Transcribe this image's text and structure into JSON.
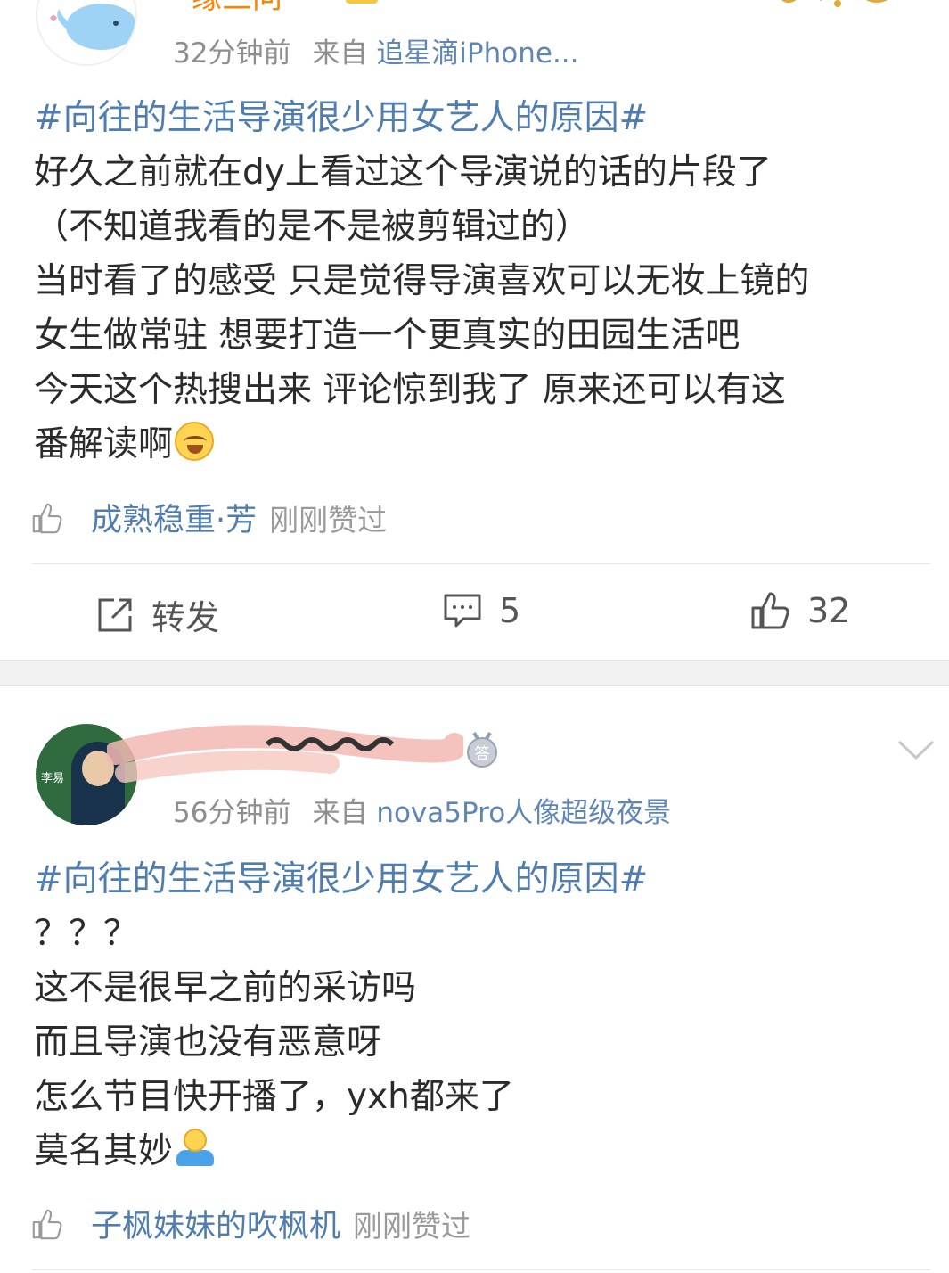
{
  "post1": {
    "username": "缘三问",
    "time": "32分钟前",
    "source_prefix": "来自",
    "source": "追星滴iPhone...",
    "hashtag": "#向往的生活导演很少用女艺人的原因#",
    "lines": [
      "好久之前就在dy上看过这个导演说的话的片段了",
      "（不知道我看的是不是被剪辑过的）",
      "当时看了的感受 只是觉得导演喜欢可以无妆上镜的",
      "女生做常驻 想要打造一个更真实的田园生活吧",
      "今天这个热搜出来 评论惊到我了 原来还可以有这"
    ],
    "last_line": "番解读啊",
    "emoji": "laugh-cry-emoji",
    "liker": "成熟稳重·芳",
    "liked_text": "刚刚赞过"
  },
  "actions": {
    "repost_label": "转发",
    "comment_count": "5",
    "like_count": "32"
  },
  "post2": {
    "username": "",
    "avatar_label": "李易",
    "time": "56分钟前",
    "source_prefix": "来自",
    "source": "nova5Pro人像超级夜景",
    "hashtag": "#向往的生活导演很少用女艺人的原因#",
    "lines": [
      "？？？",
      "这不是很早之前的采访吗",
      "而且导演也没有恶意呀",
      "怎么节目快开播了，yxh都来了"
    ],
    "last_line": "莫名其妙",
    "emoji": "shrug-emoji",
    "medal_text": "答",
    "liker": "子枫妹妹的吹枫机",
    "liked_text": "刚刚赞过"
  },
  "colors": {
    "link": "#507daf",
    "meta": "#8e8e8e",
    "text": "#2b2b2b",
    "separator": "#f2f2f2"
  }
}
